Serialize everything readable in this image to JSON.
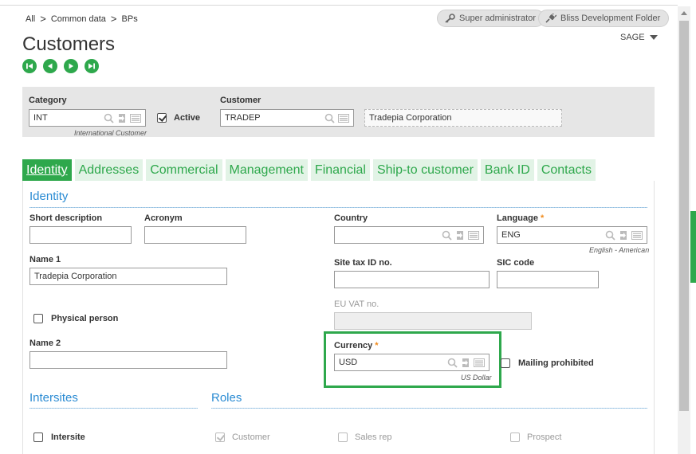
{
  "breadcrumb": {
    "items": [
      "All",
      "Common data",
      "BPs"
    ],
    "separator": ">"
  },
  "header_pills": {
    "user": "Super administrator",
    "folder": "Bliss Development Folder"
  },
  "page": {
    "title": "Customers",
    "solution": "SAGE"
  },
  "header": {
    "category": {
      "label": "Category",
      "value": "INT",
      "description": "International Customer"
    },
    "active": {
      "label": "Active",
      "checked": true
    },
    "customer": {
      "label": "Customer",
      "value": "TRADEP",
      "name": "Tradepia Corporation"
    }
  },
  "tabs": [
    "Identity",
    "Addresses",
    "Commercial",
    "Management",
    "Financial",
    "Ship-to customer",
    "Bank ID",
    "Contacts"
  ],
  "identity": {
    "section_title": "Identity",
    "short_description": {
      "label": "Short description",
      "value": ""
    },
    "acronym": {
      "label": "Acronym",
      "value": ""
    },
    "name1": {
      "label": "Name 1",
      "value": "Tradepia Corporation"
    },
    "physical_person": {
      "label": "Physical person",
      "checked": false
    },
    "name2": {
      "label": "Name 2",
      "value": ""
    },
    "country": {
      "label": "Country",
      "value": ""
    },
    "language": {
      "label": "Language",
      "value": "ENG",
      "description": "English - American",
      "required": "*"
    },
    "site_tax_id": {
      "label": "Site tax ID no.",
      "value": ""
    },
    "sic_code": {
      "label": "SIC code",
      "value": ""
    },
    "eu_vat": {
      "label": "EU VAT no.",
      "value": ""
    },
    "currency": {
      "label": "Currency",
      "value": "USD",
      "description": "US Dollar",
      "required": "*"
    },
    "mailing_prohibited": {
      "label": "Mailing prohibited",
      "checked": false
    }
  },
  "intersites": {
    "section_title": "Intersites",
    "intersite": {
      "label": "Intersite",
      "checked": false
    }
  },
  "roles": {
    "section_title": "Roles",
    "customer": {
      "label": "Customer",
      "checked": true
    },
    "sales_rep": {
      "label": "Sales rep",
      "checked": false
    },
    "prospect": {
      "label": "Prospect",
      "checked": false
    }
  },
  "colors": {
    "accent": "#2ea84c",
    "section_title": "#2a8bd3",
    "required": "#f08a1b",
    "panel": "#e6e6e6"
  },
  "icons": {
    "lookup": "magnifier-icon",
    "select": "selection-icon",
    "detail": "detail-panel-icon",
    "user": "key-icon",
    "folder": "plug-icon"
  }
}
